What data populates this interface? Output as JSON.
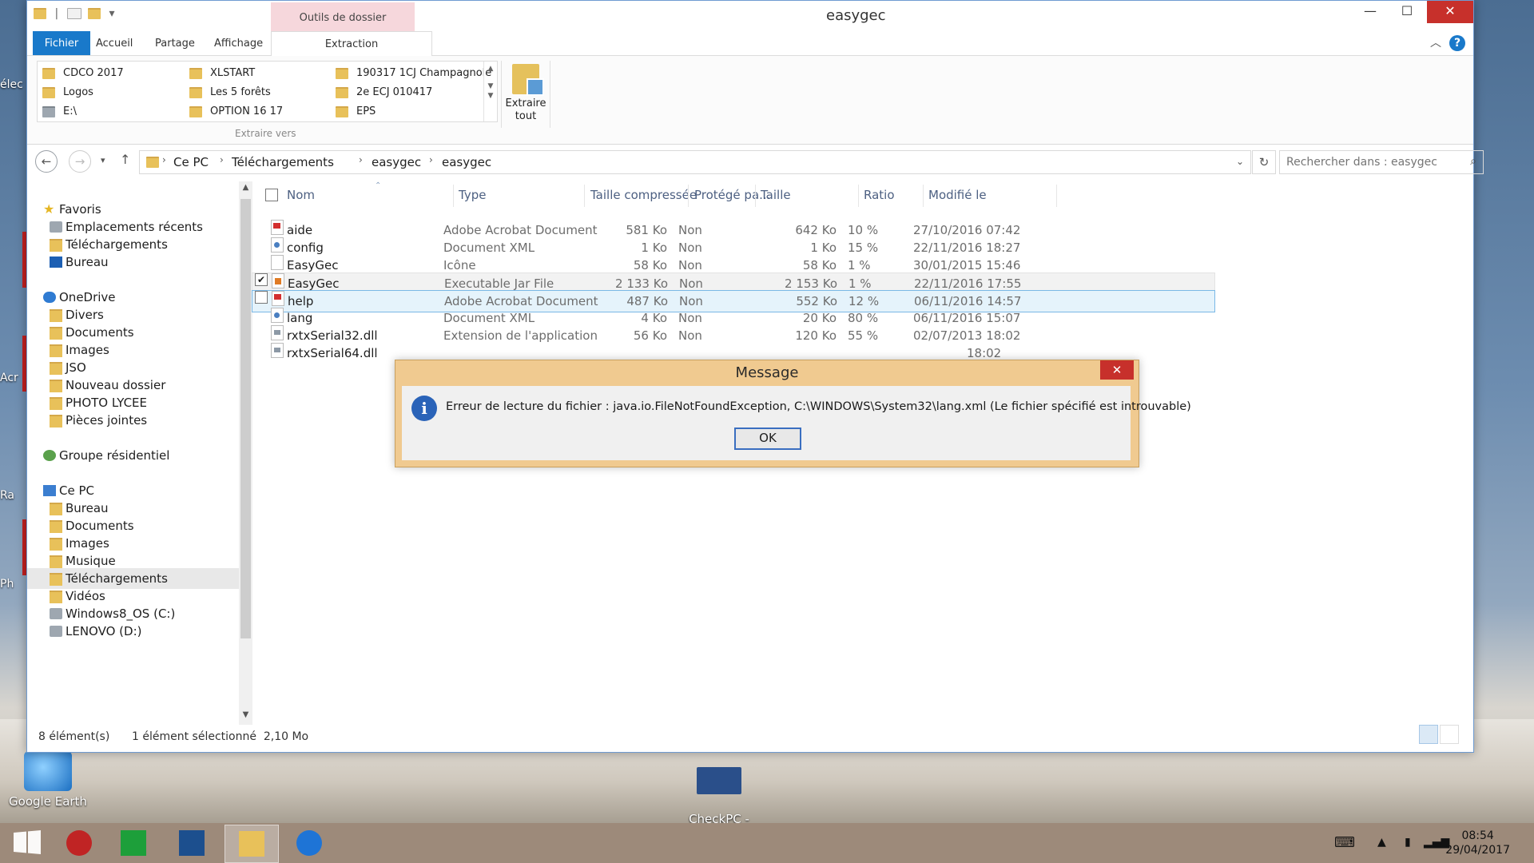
{
  "desktop": {
    "icons": [
      {
        "label": "Google Earth"
      },
      {
        "label": "CheckPC -\nRaccourci"
      }
    ],
    "edge_labels": [
      "élec",
      "Acr",
      "Ra",
      "Ph"
    ]
  },
  "window": {
    "title": "easygec",
    "context_group": "Outils de dossier compressé",
    "controls": {
      "minimize": "—",
      "maximize": "☐",
      "close": "✕"
    }
  },
  "ribbon": {
    "tabs": [
      "Fichier",
      "Accueil",
      "Partage",
      "Affichage",
      "Extraction"
    ],
    "destinations": [
      [
        "CDCO 2017",
        "XLSTART",
        "190317 1CJ Champagnole"
      ],
      [
        "Logos",
        "Les 5 forêts",
        "2e ECJ 010417"
      ],
      [
        "E:\\",
        "OPTION 16 17",
        "EPS"
      ]
    ],
    "group_label": "Extraire vers",
    "extract_all": "Extraire tout"
  },
  "address": {
    "crumbs": [
      "Ce PC",
      "Téléchargements",
      "easygec",
      "easygec"
    ],
    "search_placeholder": "Rechercher dans : easygec"
  },
  "navpane": {
    "items": [
      {
        "label": "Favoris",
        "icon": "star-icon"
      },
      {
        "label": "Emplacements récents",
        "icon": "recent-icon"
      },
      {
        "label": "Téléchargements",
        "icon": "folder-icon"
      },
      {
        "label": "Bureau",
        "icon": "desktop-icon"
      },
      {
        "label": "OneDrive",
        "icon": "cloud-icon"
      },
      {
        "label": "Divers",
        "icon": "folder-icon"
      },
      {
        "label": "Documents",
        "icon": "folder-icon"
      },
      {
        "label": "Images",
        "icon": "folder-icon"
      },
      {
        "label": "JSO",
        "icon": "folder-icon"
      },
      {
        "label": "Nouveau dossier",
        "icon": "folder-icon"
      },
      {
        "label": "PHOTO LYCEE",
        "icon": "folder-icon"
      },
      {
        "label": "Pièces jointes",
        "icon": "folder-icon"
      },
      {
        "label": "Groupe résidentiel",
        "icon": "homegroup-icon"
      },
      {
        "label": "Ce PC",
        "icon": "computer-icon"
      },
      {
        "label": "Bureau",
        "icon": "folder-icon"
      },
      {
        "label": "Documents",
        "icon": "folder-icon"
      },
      {
        "label": "Images",
        "icon": "folder-icon"
      },
      {
        "label": "Musique",
        "icon": "folder-icon"
      },
      {
        "label": "Téléchargements",
        "icon": "folder-icon"
      },
      {
        "label": "Vidéos",
        "icon": "folder-icon"
      },
      {
        "label": "Windows8_OS (C:)",
        "icon": "drive-icon"
      },
      {
        "label": "LENOVO (D:)",
        "icon": "drive-icon"
      }
    ]
  },
  "filelist": {
    "columns": [
      "Nom",
      "Type",
      "Taille compressée",
      "Protégé pa...",
      "Taille",
      "Ratio",
      "Modifié le"
    ],
    "rows": [
      {
        "name": "aide",
        "type": "Adobe Acrobat Document",
        "csize": "581 Ko",
        "prot": "Non",
        "size": "642 Ko",
        "ratio": "10 %",
        "date": "27/10/2016 07:42",
        "icon": "pdf"
      },
      {
        "name": "config",
        "type": "Document XML",
        "csize": "1 Ko",
        "prot": "Non",
        "size": "1 Ko",
        "ratio": "15 %",
        "date": "22/11/2016 18:27",
        "icon": "xml"
      },
      {
        "name": "EasyGec",
        "type": "Icône",
        "csize": "58 Ko",
        "prot": "Non",
        "size": "58 Ko",
        "ratio": "1 %",
        "date": "30/01/2015 15:46",
        "icon": "ico"
      },
      {
        "name": "EasyGec",
        "type": "Executable Jar File",
        "csize": "2 133 Ko",
        "prot": "Non",
        "size": "2 153 Ko",
        "ratio": "1 %",
        "date": "22/11/2016 17:55",
        "icon": "jar"
      },
      {
        "name": "help",
        "type": "Adobe Acrobat Document",
        "csize": "487 Ko",
        "prot": "Non",
        "size": "552 Ko",
        "ratio": "12 %",
        "date": "06/11/2016 14:57",
        "icon": "pdf"
      },
      {
        "name": "lang",
        "type": "Document XML",
        "csize": "4 Ko",
        "prot": "Non",
        "size": "20 Ko",
        "ratio": "80 %",
        "date": "06/11/2016 15:07",
        "icon": "xml"
      },
      {
        "name": "rxtxSerial32.dll",
        "type": "Extension de l'application",
        "csize": "56 Ko",
        "prot": "Non",
        "size": "120 Ko",
        "ratio": "55 %",
        "date": "02/07/2013 18:02",
        "icon": "dll"
      },
      {
        "name": "rxtxSerial64.dll",
        "type": "",
        "csize": "",
        "prot": "",
        "size": "",
        "ratio": "",
        "date": "18:02",
        "icon": "dll"
      }
    ]
  },
  "status": {
    "count": "8 élément(s)",
    "selection": "1 élément sélectionné  2,10 Mo"
  },
  "dialog": {
    "title": "Message",
    "message": "Erreur de lecture du fichier : java.io.FileNotFoundException, C:\\WINDOWS\\System32\\lang.xml (Le fichier spécifié est introuvable)",
    "ok": "OK",
    "close": "✕"
  },
  "taskbar": {
    "time": "08:54",
    "date": "29/04/2017"
  }
}
